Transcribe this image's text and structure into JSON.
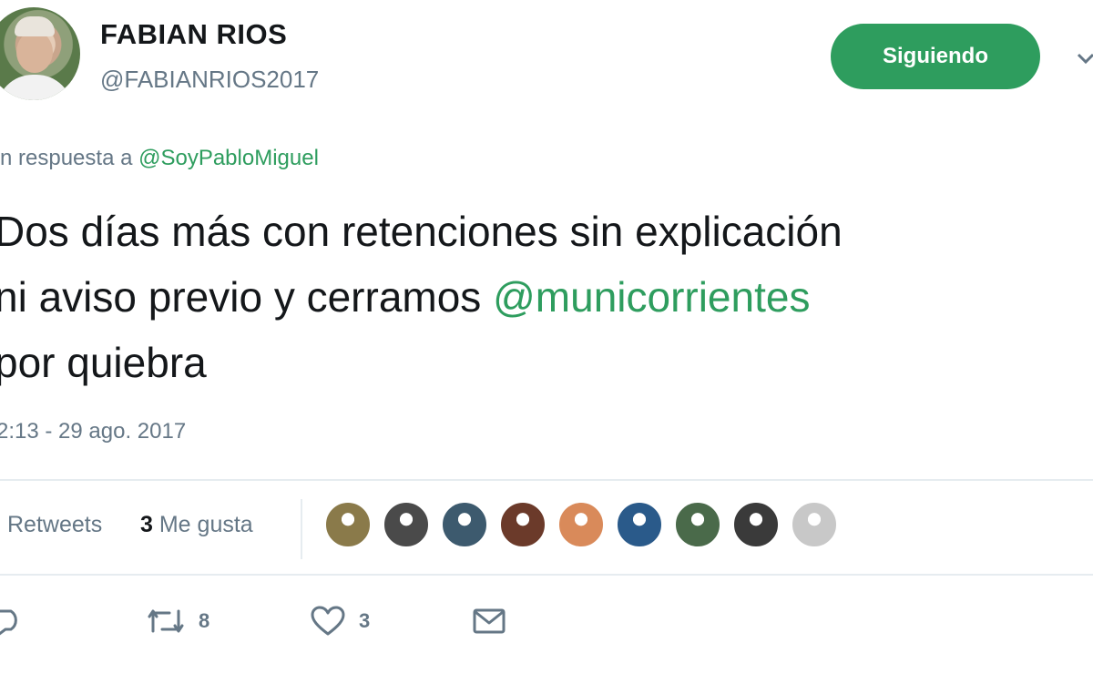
{
  "user": {
    "name": "FABIAN RIOS",
    "handle": "@FABIANRIOS2017"
  },
  "follow_button": {
    "label": "Siguiendo"
  },
  "reply": {
    "prefix": "n respuesta a ",
    "mention": "@SoyPabloMiguel"
  },
  "tweet": {
    "line1": "Dos días más con retenciones sin explicación",
    "line2_prefix": "ni aviso previo y cerramos ",
    "line2_mention": "@municorrientes",
    "line3": "por quiebra"
  },
  "timestamp": "2:13 - 29 ago. 2017",
  "stats": {
    "retweets_label": "Retweets",
    "likes_count": "3",
    "likes_label": "Me gusta"
  },
  "likers": [
    {
      "icon": "liker-avatar-1",
      "color": "#8a7a4a"
    },
    {
      "icon": "liker-avatar-2",
      "color": "#4a4a4a"
    },
    {
      "icon": "liker-avatar-3",
      "color": "#3d5a6e"
    },
    {
      "icon": "liker-avatar-4",
      "color": "#6b3a2a"
    },
    {
      "icon": "liker-avatar-5",
      "color": "#d98a5a"
    },
    {
      "icon": "liker-avatar-6",
      "color": "#2a5a8a"
    },
    {
      "icon": "liker-avatar-7",
      "color": "#4a6a4a"
    },
    {
      "icon": "liker-avatar-8",
      "color": "#3a3a3a"
    },
    {
      "icon": "liker-avatar-9",
      "color": "#c8c8c8"
    }
  ],
  "actions": {
    "reply_icon": "reply-icon",
    "retweet_icon": "retweet-icon",
    "retweet_count": "8",
    "like_icon": "heart-icon",
    "like_count": "3",
    "message_icon": "envelope-icon"
  },
  "colors": {
    "accent": "#2e9d5e",
    "muted": "#657786",
    "text": "#14171a",
    "divider": "#e6ecf0"
  }
}
